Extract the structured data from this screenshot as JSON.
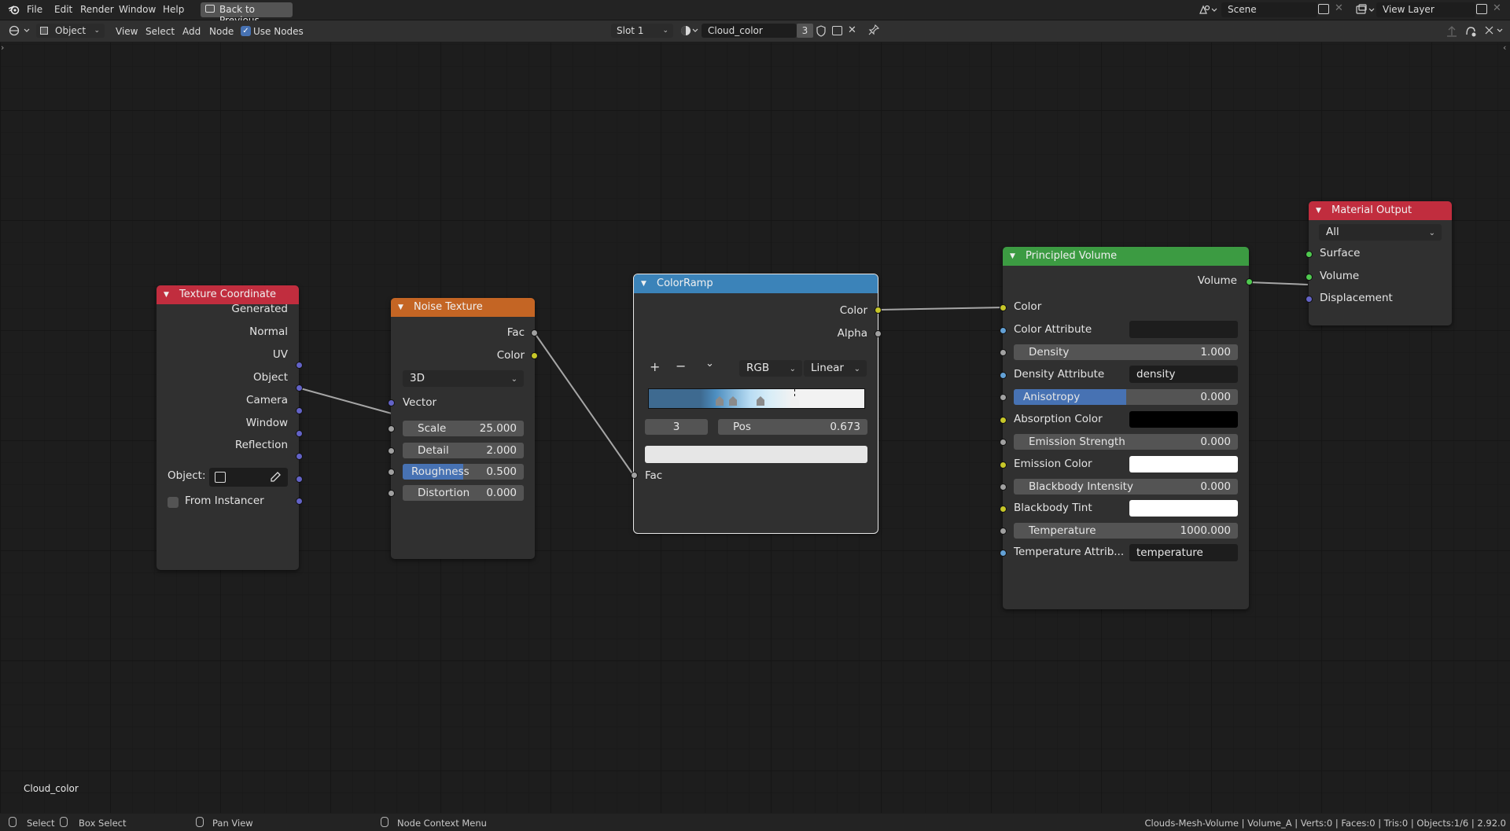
{
  "topbar": {
    "menu": [
      "File",
      "Edit",
      "Render",
      "Window",
      "Help"
    ],
    "back_button": "Back to Previous",
    "scene_name": "Scene",
    "view_layer_name": "View Layer"
  },
  "header": {
    "mode": "Object",
    "menu": [
      "View",
      "Select",
      "Add",
      "Node"
    ],
    "use_nodes_label": "Use Nodes",
    "use_nodes_checked": true,
    "slot": "Slot 1",
    "material_name": "Cloud_color",
    "material_users": "3"
  },
  "nodes": {
    "texture_coordinate": {
      "title": "Texture Coordinate",
      "outputs": [
        "Generated",
        "Normal",
        "UV",
        "Object",
        "Camera",
        "Window",
        "Reflection"
      ],
      "object_label": "Object:",
      "from_instancer_label": "From Instancer",
      "header_color": "#c12d3e"
    },
    "noise_texture": {
      "title": "Noise Texture",
      "outputs": [
        "Fac",
        "Color"
      ],
      "dimensions": "3D",
      "vector_label": "Vector",
      "scale_label": "Scale",
      "scale_value": "25.000",
      "detail_label": "Detail",
      "detail_value": "2.000",
      "roughness_label": "Roughness",
      "roughness_value": "0.500",
      "distortion_label": "Distortion",
      "distortion_value": "0.000",
      "header_color": "#c46524"
    },
    "color_ramp": {
      "title": "ColorRamp",
      "outputs": [
        "Color",
        "Alpha"
      ],
      "color_mode": "RGB",
      "interpolation": "Linear",
      "active_stop_index": "3",
      "pos_label": "Pos",
      "pos_value": "0.673",
      "input_label": "Fac",
      "header_color": "#3b83b9"
    },
    "principled_volume": {
      "title": "Principled Volume",
      "output": "Volume",
      "color_label": "Color",
      "color_attribute_label": "Color Attribute",
      "density_label": "Density",
      "density_value": "1.000",
      "density_attribute_label": "Density Attribute",
      "density_attribute_value": "density",
      "anisotropy_label": "Anisotropy",
      "anisotropy_value": "0.000",
      "absorption_color_label": "Absorption Color",
      "emission_strength_label": "Emission Strength",
      "emission_strength_value": "0.000",
      "emission_color_label": "Emission Color",
      "blackbody_intensity_label": "Blackbody Intensity",
      "blackbody_intensity_value": "0.000",
      "blackbody_tint_label": "Blackbody Tint",
      "temperature_label": "Temperature",
      "temperature_value": "1000.000",
      "temperature_attribute_label": "Temperature Attrib...",
      "temperature_attribute_value": "temperature",
      "header_color": "#3c9b42"
    },
    "material_output": {
      "title": "Material Output",
      "target": "All",
      "inputs": [
        "Surface",
        "Volume",
        "Displacement"
      ],
      "header_color": "#c12d3e"
    }
  },
  "overlay_material_name": "Cloud_color",
  "statusbar": {
    "select": "Select",
    "box_select": "Box Select",
    "pan_view": "Pan View",
    "context_menu": "Node Context Menu",
    "stats": "Clouds-Mesh-Volume | Volume_A | Verts:0 | Faces:0 | Tris:0 | Objects:1/6 | 2.92.0"
  },
  "icons": [
    "blender-logo-icon",
    "back-icon",
    "scene-icon",
    "view-layer-icon",
    "editor-type-icon",
    "object-mode-icon",
    "material-sphere-icon",
    "shield-icon",
    "duplicate-icon",
    "close-icon",
    "pin-icon",
    "eyedropper-icon",
    "mouse-icon"
  ]
}
